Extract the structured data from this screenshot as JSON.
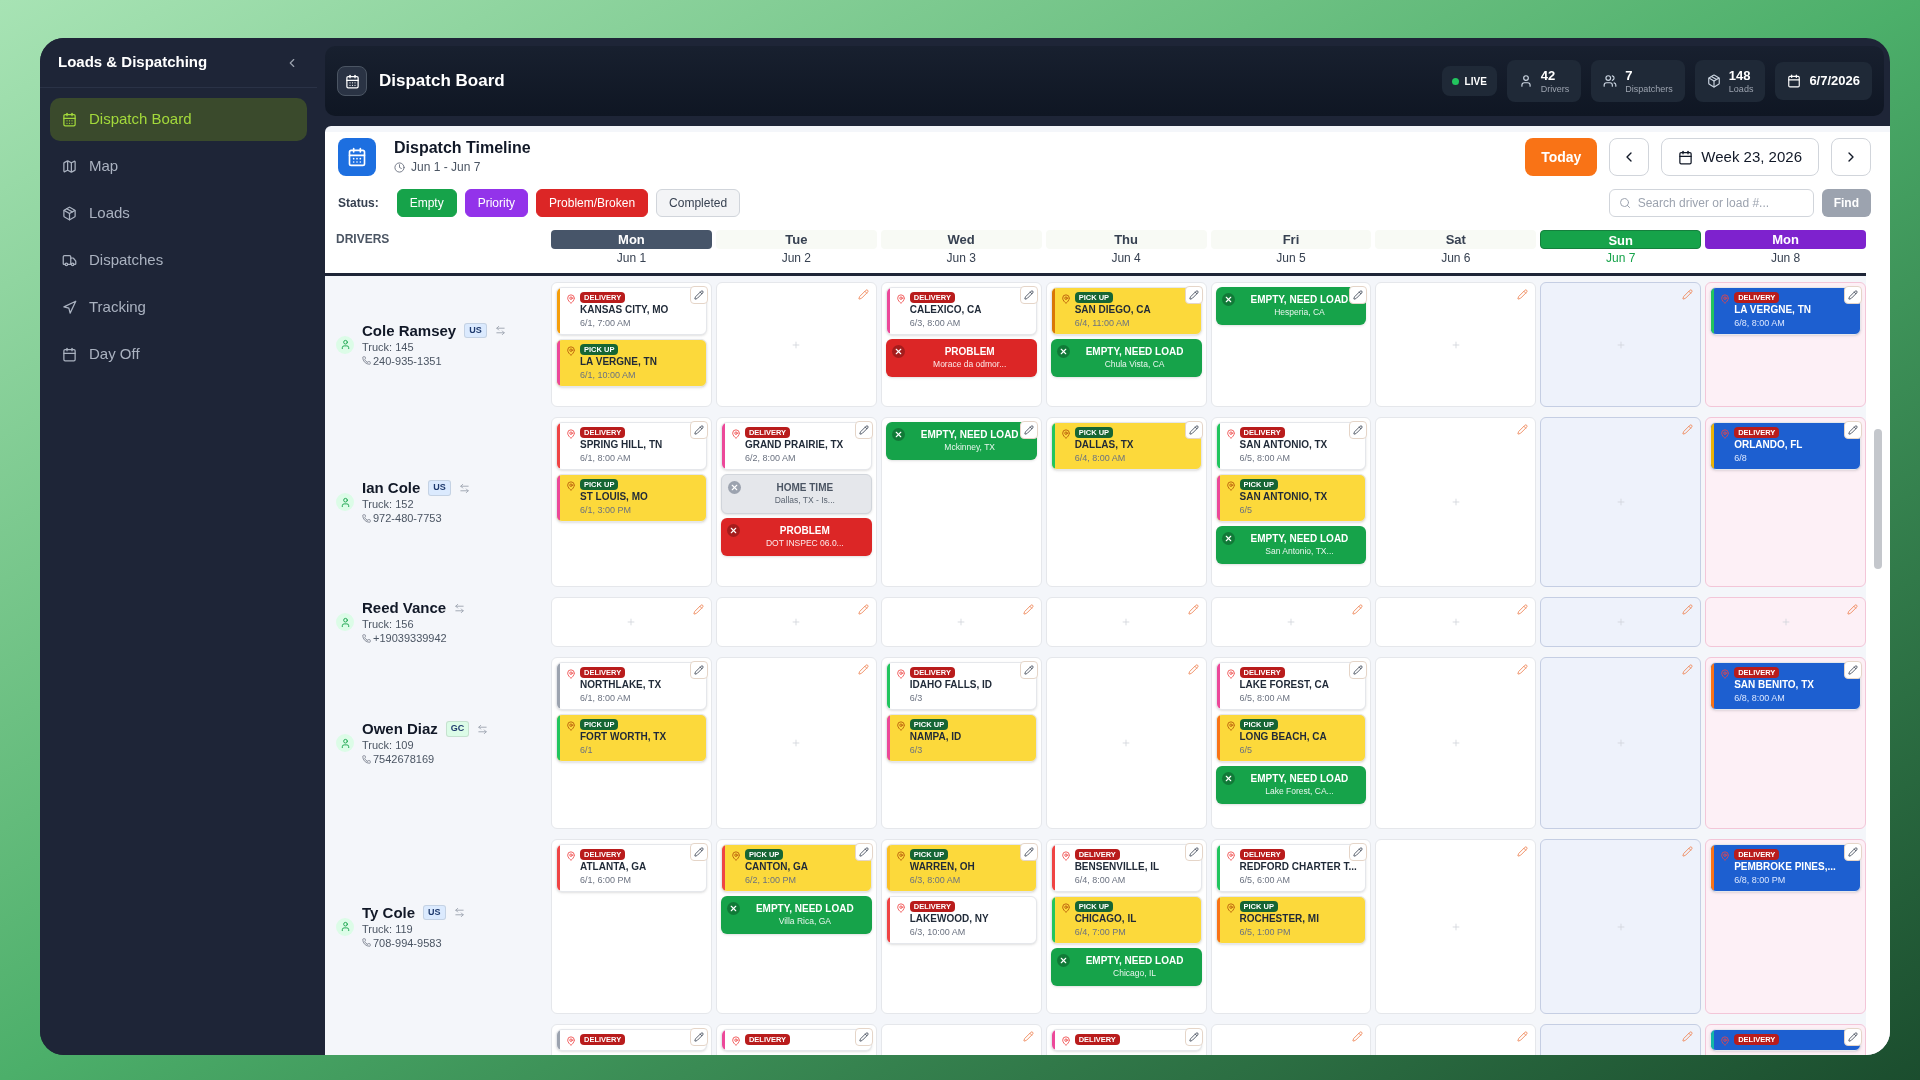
{
  "sidebar": {
    "title": "Loads & Dispatching",
    "items": [
      {
        "label": "Dispatch Board",
        "selected": true
      },
      {
        "label": "Map",
        "selected": false
      },
      {
        "label": "Loads",
        "selected": false
      },
      {
        "label": "Dispatches",
        "selected": false
      },
      {
        "label": "Tracking",
        "selected": false
      },
      {
        "label": "Day Off",
        "selected": false
      }
    ]
  },
  "header": {
    "title": "Dispatch Board",
    "live": "LIVE",
    "stats": [
      {
        "value": "42",
        "label": "Drivers"
      },
      {
        "value": "7",
        "label": "Dispatchers"
      },
      {
        "value": "148",
        "label": "Loads"
      }
    ],
    "date": "6/7/2026"
  },
  "timeline": {
    "title": "Dispatch Timeline",
    "range": "Jun 1 - Jun 7",
    "today": "Today",
    "week": "Week 23, 2026"
  },
  "status": {
    "label": "Status:",
    "filters": [
      {
        "label": "Empty",
        "kind": "empty"
      },
      {
        "label": "Priority",
        "kind": "priority"
      },
      {
        "label": "Problem/Broken",
        "kind": "problem"
      },
      {
        "label": "Completed",
        "kind": "completed"
      }
    ],
    "search": {
      "placeholder": "Search driver or load #..."
    },
    "find": "Find"
  },
  "grid": {
    "drivers_heading": "DRIVERS",
    "days": [
      {
        "day": "Mon",
        "date": "Jun 1",
        "kind": "current"
      },
      {
        "day": "Tue",
        "date": "Jun 2",
        "kind": "normal"
      },
      {
        "day": "Wed",
        "date": "Jun 3",
        "kind": "normal"
      },
      {
        "day": "Thu",
        "date": "Jun 4",
        "kind": "normal"
      },
      {
        "day": "Fri",
        "date": "Jun 5",
        "kind": "normal"
      },
      {
        "day": "Sat",
        "date": "Jun 6",
        "kind": "normal"
      },
      {
        "day": "Sun",
        "date": "Jun 7",
        "kind": "today"
      },
      {
        "day": "Mon",
        "date": "Jun 8",
        "kind": "next"
      }
    ]
  },
  "drivers": [
    {
      "name": "Cole Ramsey",
      "tag": {
        "label": "US",
        "color": "#dbeafe"
      },
      "truck": "Truck: 145",
      "phone": "240-935-1351",
      "cells": [
        {
          "stops": [
            {
              "kind": "delivery",
              "badge": "DELIVERY",
              "city": "KANSAS CITY, MO",
              "time": "6/1, 7:00 AM",
              "color": "#f59e0b"
            },
            {
              "kind": "pickup",
              "badge": "PICK UP",
              "city": "LA VERGNE, TN",
              "time": "6/1, 10:00 AM",
              "color": "#ec4899"
            }
          ]
        },
        {},
        {
          "stops": [
            {
              "kind": "delivery",
              "badge": "DELIVERY",
              "city": "CALEXICO, CA",
              "time": "6/3, 8:00 AM",
              "color": "#ec4899"
            },
            {
              "kind": "problem",
              "title": "PROBLEM",
              "note": "Morace da odmor..."
            }
          ]
        },
        {
          "stops": [
            {
              "kind": "pickup",
              "badge": "PICK UP",
              "city": "SAN DIEGO, CA",
              "time": "6/4, 11:00 AM",
              "color": "#d97706"
            },
            {
              "kind": "empty",
              "title": "EMPTY, NEED LOAD",
              "note": "Chula Vista, CA"
            }
          ]
        },
        {
          "stops": [
            {
              "kind": "empty",
              "title": "EMPTY, NEED LOAD",
              "note": "Hesperia, CA"
            }
          ]
        },
        {},
        {},
        {
          "stops": [
            {
              "kind": "delivery",
              "badge": "DELIVERY",
              "city": "LA VERGNE, TN",
              "time": "6/8, 8:00 AM",
              "color": "#22c55e"
            }
          ]
        }
      ]
    },
    {
      "name": "Ian Cole",
      "tag": {
        "label": "US",
        "color": "#dbeafe"
      },
      "truck": "Truck: 152",
      "phone": "972-480-7753",
      "cells": [
        {
          "stops": [
            {
              "kind": "delivery",
              "badge": "DELIVERY",
              "city": "SPRING HILL, TN",
              "time": "6/1, 8:00 AM",
              "color": "#ef4444"
            },
            {
              "kind": "pickup",
              "badge": "PICK UP",
              "city": "ST LOUIS, MO",
              "time": "6/1, 3:00 PM",
              "color": "#ec4899"
            }
          ]
        },
        {
          "stops": [
            {
              "kind": "delivery",
              "badge": "DELIVERY",
              "city": "GRAND PRAIRIE, TX",
              "time": "6/2, 8:00 AM",
              "color": "#ec4899"
            },
            {
              "kind": "home",
              "title": "HOME TIME",
              "note": "Dallas, TX - Is..."
            },
            {
              "kind": "problem",
              "title": "PROBLEM",
              "note": "DOT INSPEC 06.0..."
            }
          ]
        },
        {
          "stops": [
            {
              "kind": "empty",
              "title": "EMPTY, NEED LOAD",
              "note": "Mckinney, TX"
            }
          ]
        },
        {
          "stops": [
            {
              "kind": "pickup",
              "badge": "PICK UP",
              "city": "DALLAS, TX",
              "time": "6/4, 8:00 AM",
              "color": "#22c55e"
            }
          ]
        },
        {
          "stops": [
            {
              "kind": "delivery",
              "badge": "DELIVERY",
              "city": "SAN ANTONIO, TX",
              "time": "6/5, 8:00 AM",
              "color": "#22c55e"
            },
            {
              "kind": "pickup",
              "badge": "PICK UP",
              "city": "SAN ANTONIO, TX",
              "time": "6/5",
              "color": "#ec4899"
            },
            {
              "kind": "empty",
              "title": "EMPTY, NEED LOAD",
              "note": "San Antonio, TX..."
            }
          ]
        },
        {},
        {},
        {
          "stops": [
            {
              "kind": "delivery",
              "badge": "DELIVERY",
              "city": "ORLANDO, FL",
              "time": "6/8",
              "color": "#eab308"
            }
          ]
        }
      ]
    },
    {
      "name": "Reed Vance",
      "truck": "Truck: 156",
      "phone": "+19039339942",
      "cells": [
        {},
        {},
        {},
        {},
        {},
        {},
        {},
        {}
      ]
    },
    {
      "name": "Owen Diaz",
      "tag": {
        "label": "GC",
        "color": "#dcfce7"
      },
      "truck": "Truck: 109",
      "phone": "7542678169",
      "cells": [
        {
          "stops": [
            {
              "kind": "delivery",
              "badge": "DELIVERY",
              "city": "NORTHLAKE, TX",
              "time": "6/1, 8:00 AM",
              "color": "#9ca3af"
            },
            {
              "kind": "pickup",
              "badge": "PICK UP",
              "city": "FORT WORTH, TX",
              "time": "6/1",
              "color": "#22c55e"
            }
          ]
        },
        {},
        {
          "stops": [
            {
              "kind": "delivery",
              "badge": "DELIVERY",
              "city": "IDAHO FALLS, ID",
              "time": "6/3",
              "color": "#22c55e"
            },
            {
              "kind": "pickup",
              "badge": "PICK UP",
              "city": "NAMPA, ID",
              "time": "6/3",
              "color": "#ec4899"
            }
          ]
        },
        {},
        {
          "stops": [
            {
              "kind": "delivery",
              "badge": "DELIVERY",
              "city": "LAKE FOREST, CA",
              "time": "6/5, 8:00 AM",
              "color": "#ec4899"
            },
            {
              "kind": "pickup",
              "badge": "PICK UP",
              "city": "LONG BEACH, CA",
              "time": "6/5",
              "color": "#f97316"
            },
            {
              "kind": "empty",
              "title": "EMPTY, NEED LOAD",
              "note": "Lake Forest, CA..."
            }
          ]
        },
        {},
        {},
        {
          "stops": [
            {
              "kind": "delivery",
              "badge": "DELIVERY",
              "city": "SAN BENITO, TX",
              "time": "6/8, 8:00 AM",
              "color": "#f97316"
            }
          ]
        }
      ]
    },
    {
      "name": "Ty Cole",
      "tag": {
        "label": "US",
        "color": "#dbeafe"
      },
      "truck": "Truck: 119",
      "phone": "708-994-9583",
      "cells": [
        {
          "stops": [
            {
              "kind": "delivery",
              "badge": "DELIVERY",
              "city": "ATLANTA, GA",
              "time": "6/1, 6:00 PM",
              "color": "#ef4444"
            }
          ]
        },
        {
          "stops": [
            {
              "kind": "pickup",
              "badge": "PICK UP",
              "city": "CANTON, GA",
              "time": "6/2, 1:00 PM",
              "color": "#ef4444"
            },
            {
              "kind": "empty",
              "title": "EMPTY, NEED LOAD",
              "note": "Villa Rica, GA"
            }
          ]
        },
        {
          "stops": [
            {
              "kind": "pickup",
              "badge": "PICK UP",
              "city": "WARREN, OH",
              "time": "6/3, 8:00 AM",
              "color": "#fbbf24"
            },
            {
              "kind": "delivery",
              "badge": "DELIVERY",
              "city": "LAKEWOOD, NY",
              "time": "6/3, 10:00 AM",
              "color": "#ef4444"
            }
          ]
        },
        {
          "stops": [
            {
              "kind": "delivery",
              "badge": "DELIVERY",
              "city": "BENSENVILLE, IL",
              "time": "6/4, 8:00 AM",
              "color": "#ef4444"
            },
            {
              "kind": "pickup",
              "badge": "PICK UP",
              "city": "CHICAGO, IL",
              "time": "6/4, 7:00 PM",
              "color": "#22c55e"
            },
            {
              "kind": "empty",
              "title": "EMPTY, NEED LOAD",
              "note": "Chicago, IL"
            }
          ]
        },
        {
          "stops": [
            {
              "kind": "delivery",
              "badge": "DELIVERY",
              "city": "REDFORD CHARTER T...",
              "time": "6/5, 6:00 AM",
              "color": "#22c55e"
            },
            {
              "kind": "pickup",
              "badge": "PICK UP",
              "city": "ROCHESTER, MI",
              "time": "6/5, 1:00 PM",
              "color": "#f97316"
            }
          ]
        },
        {},
        {},
        {
          "stops": [
            {
              "kind": "delivery",
              "badge": "DELIVERY",
              "city": "PEMBROKE PINES,...",
              "time": "6/8, 8:00 PM",
              "color": "#f97316"
            }
          ]
        }
      ]
    },
    {
      "cells": [
        {
          "stops": [
            {
              "kind": "delivery",
              "badge": "DELIVERY",
              "color": "#9ca3af"
            }
          ]
        },
        {
          "stops": [
            {
              "kind": "delivery",
              "badge": "DELIVERY",
              "color": "#ec4899"
            }
          ]
        },
        {},
        {
          "stops": [
            {
              "kind": "delivery",
              "badge": "DELIVERY",
              "color": "#ec4899"
            }
          ]
        },
        {},
        {},
        {},
        {
          "stops": [
            {
              "kind": "delivery",
              "badge": "DELIVERY",
              "color": "#14b8a6"
            }
          ]
        }
      ]
    }
  ]
}
